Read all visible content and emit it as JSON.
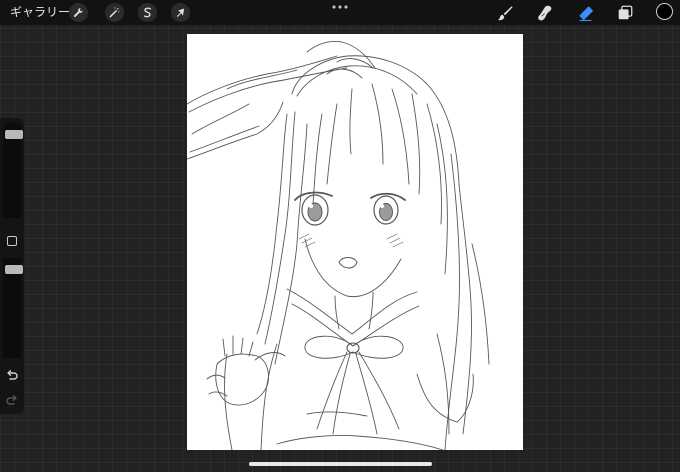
{
  "topbar": {
    "gallery_label": "ギャラリー",
    "left_tools": [
      {
        "name": "actions",
        "icon": "wrench-icon"
      },
      {
        "name": "adjustments",
        "icon": "magic-wand-icon"
      },
      {
        "name": "selection",
        "icon": "selection-s-icon"
      },
      {
        "name": "transform",
        "icon": "arrow-cursor-icon"
      }
    ],
    "right_tools": [
      {
        "name": "brush",
        "icon": "brush-icon",
        "active": false
      },
      {
        "name": "smudge",
        "icon": "smudge-icon",
        "active": false
      },
      {
        "name": "eraser",
        "icon": "eraser-icon",
        "active": true
      },
      {
        "name": "layers",
        "icon": "layers-icon",
        "active": false
      }
    ],
    "current_color": "#000000"
  },
  "sidebar": {
    "brush_size_level": 0.08,
    "opacity_level": 0.08
  },
  "colors": {
    "active_tool": "#3f8cff",
    "icon": "#d8d8d8",
    "background": "#222222",
    "canvas": "#ffffff"
  }
}
